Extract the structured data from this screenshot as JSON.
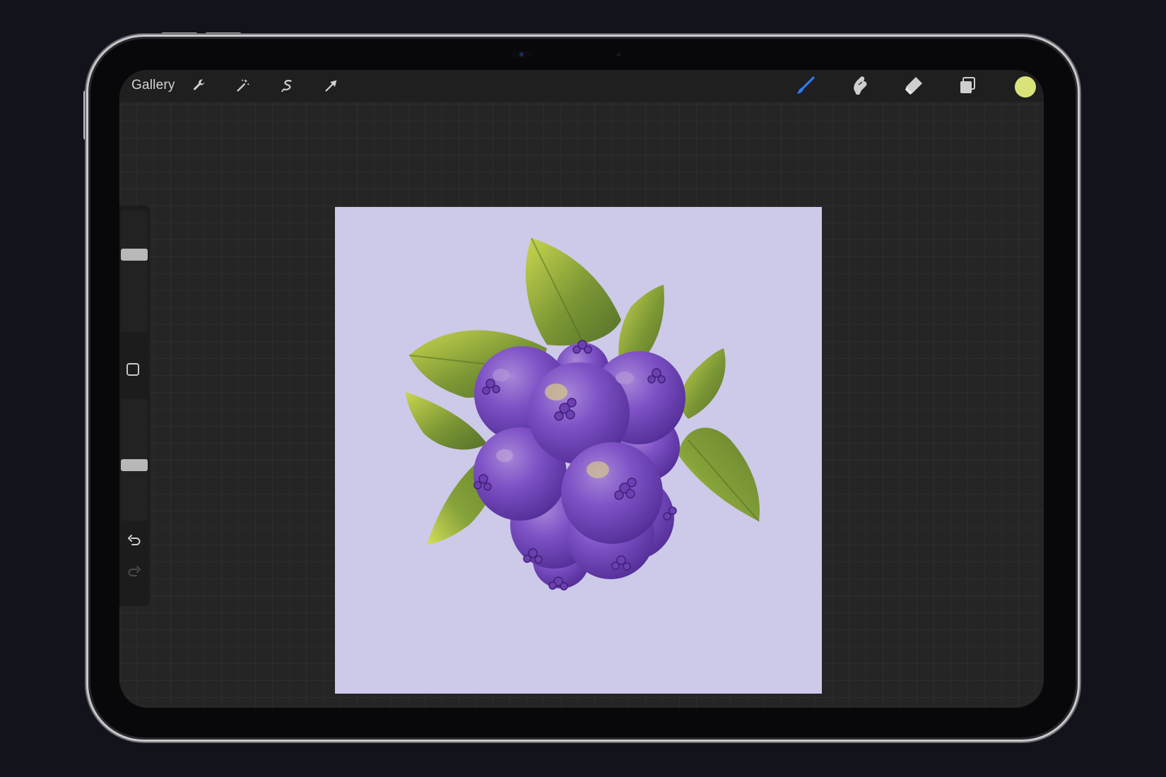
{
  "toolbar": {
    "gallery_label": "Gallery",
    "actions_icon": "wrench-icon",
    "adjustments_icon": "magic-wand-icon",
    "selection_icon": "selection-s-icon",
    "transform_icon": "arrow-cursor-icon",
    "brush_icon": "brush-icon",
    "smudge_icon": "smudge-finger-icon",
    "eraser_icon": "eraser-icon",
    "layers_icon": "layers-icon",
    "current_color": "#d9e37a"
  },
  "sidebar": {
    "brush_size_level": 0.35,
    "opacity_level": 0.55,
    "modify_icon": "square-icon",
    "undo_icon": "undo-icon",
    "redo_icon": "redo-icon"
  },
  "canvas": {
    "background_color": "#cdc9e9",
    "artwork": "blueberry-cluster-illustration"
  },
  "colors": {
    "accent_blue": "#2b7cf6",
    "berry": "#7a4bc2",
    "leaf": "#6f8b2c"
  }
}
